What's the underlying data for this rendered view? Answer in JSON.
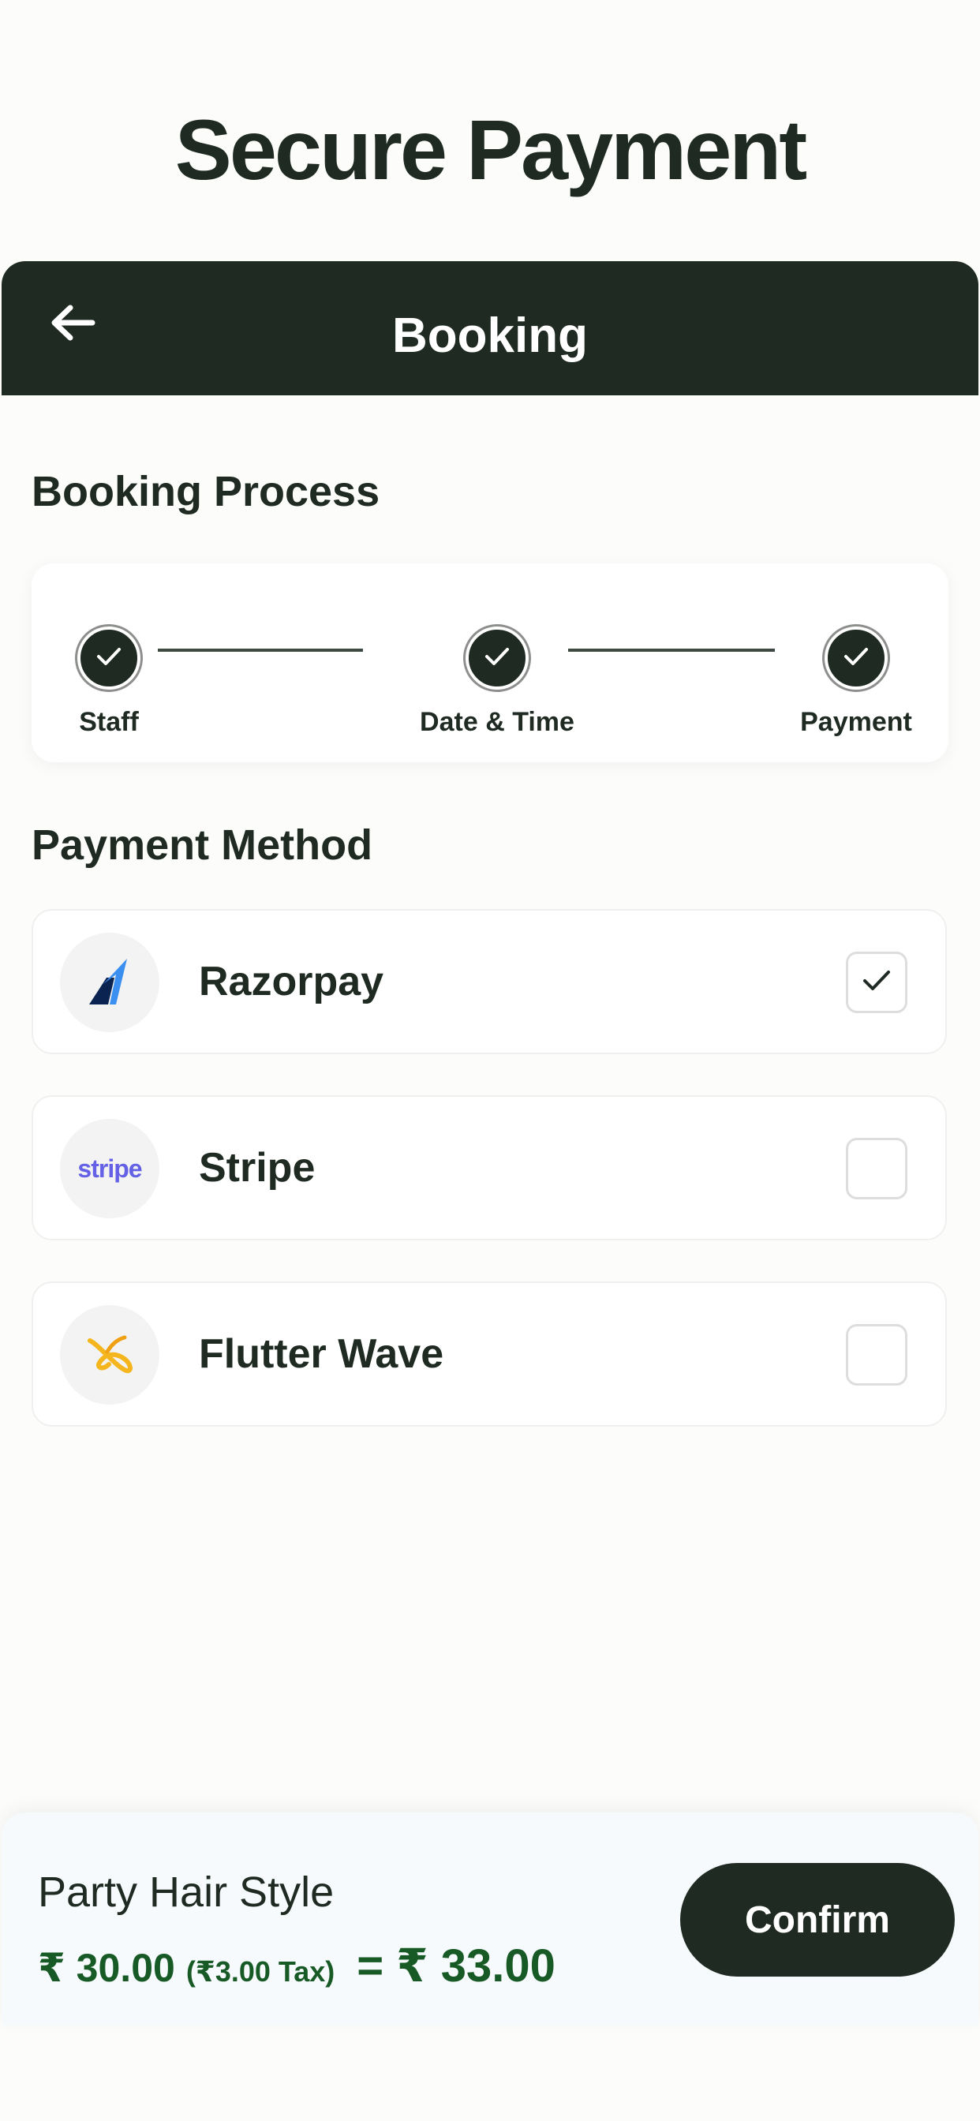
{
  "hero": {
    "title": "Secure Payment"
  },
  "app_bar": {
    "title": "Booking",
    "back_icon": "arrow-left-icon"
  },
  "booking_process": {
    "title": "Booking Process",
    "steps": [
      {
        "label": "Staff",
        "completed": true
      },
      {
        "label": "Date & Time",
        "completed": true
      },
      {
        "label": "Payment",
        "completed": true
      }
    ]
  },
  "payment_method": {
    "title": "Payment Method",
    "options": [
      {
        "name": "Razorpay",
        "logo": "razorpay-logo-icon",
        "selected": true
      },
      {
        "name": "Stripe",
        "logo": "stripe-logo",
        "logo_text": "stripe",
        "selected": false
      },
      {
        "name": "Flutter Wave",
        "logo": "flutterwave-logo-icon",
        "selected": false
      }
    ]
  },
  "summary": {
    "service_name": "Party Hair Style",
    "price": "₹ 30.00",
    "tax": "(₹3.00 Tax)",
    "total": "= ₹ 33.00",
    "confirm_label": "Confirm"
  },
  "colors": {
    "primary": "#1f2a22",
    "price_green": "#175a26",
    "background": "#fcfdfb",
    "stripe_purple": "#6461e6",
    "razorpay_blue": "#3b8ff0",
    "flutterwave_yellow": "#f5b51d"
  }
}
